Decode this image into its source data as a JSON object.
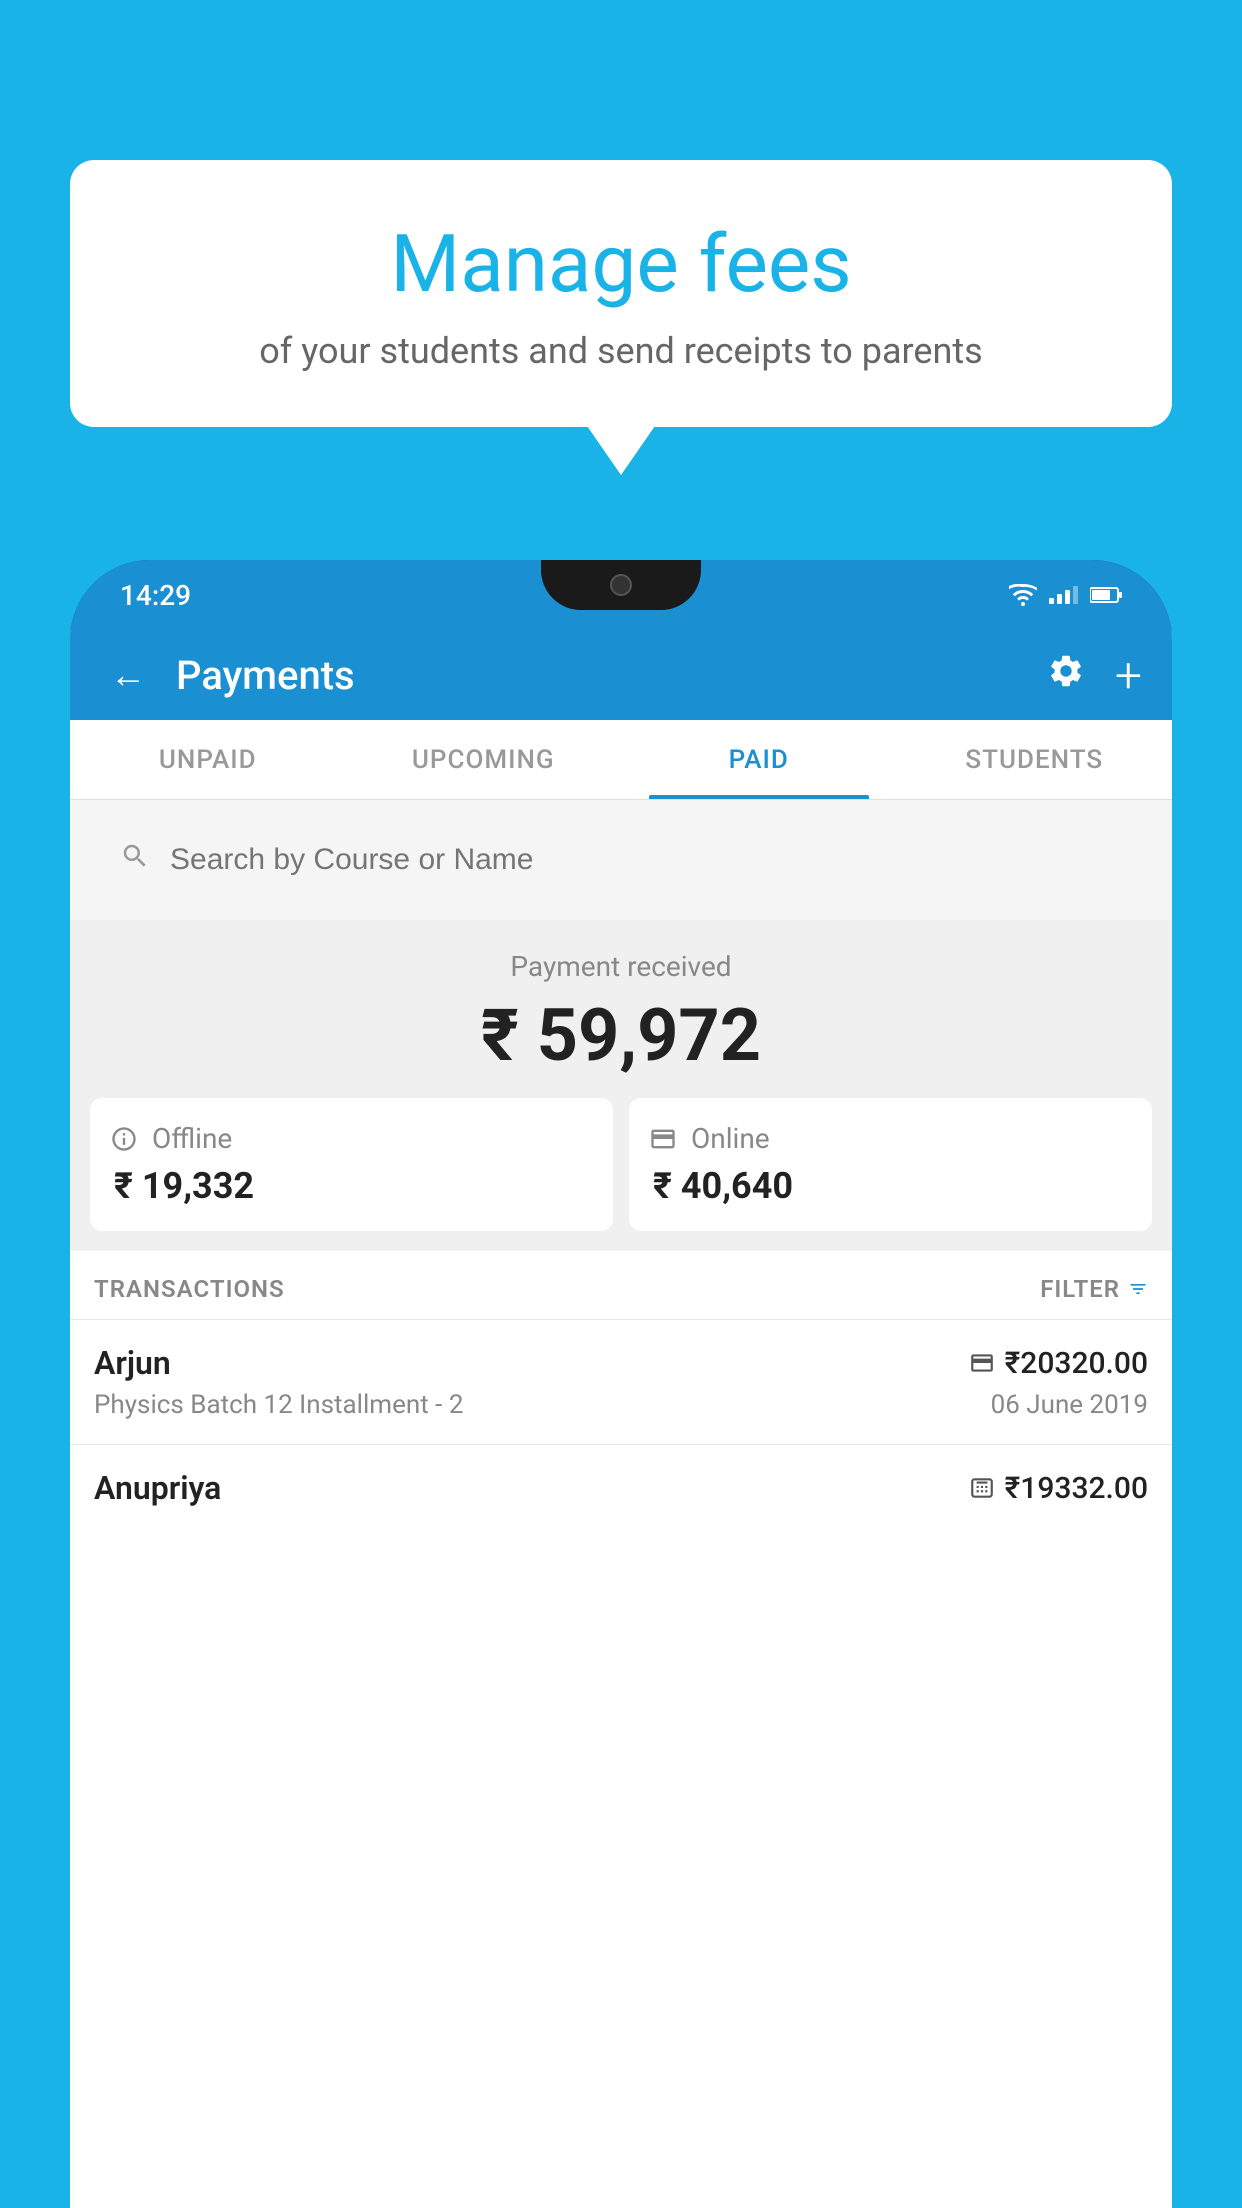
{
  "background_color": "#1ab3e8",
  "bubble": {
    "title": "Manage fees",
    "subtitle": "of your students and send receipts to parents"
  },
  "status_bar": {
    "time": "14:29"
  },
  "top_bar": {
    "title": "Payments",
    "back_label": "←",
    "gear_label": "⚙",
    "plus_label": "+"
  },
  "tabs": [
    {
      "label": "UNPAID",
      "active": false
    },
    {
      "label": "UPCOMING",
      "active": false
    },
    {
      "label": "PAID",
      "active": true
    },
    {
      "label": "STUDENTS",
      "active": false
    }
  ],
  "search": {
    "placeholder": "Search by Course or Name"
  },
  "payment_summary": {
    "label": "Payment received",
    "total": "₹ 59,972",
    "offline": {
      "label": "Offline",
      "amount": "₹ 19,332"
    },
    "online": {
      "label": "Online",
      "amount": "₹ 40,640"
    }
  },
  "transactions_section": {
    "label": "TRANSACTIONS",
    "filter_label": "FILTER"
  },
  "transactions": [
    {
      "name": "Arjun",
      "amount": "₹20320.00",
      "course": "Physics Batch 12 Installment - 2",
      "date": "06 June 2019",
      "payment_type": "card"
    },
    {
      "name": "Anupriya",
      "amount": "₹19332.00",
      "course": "",
      "date": "",
      "payment_type": "offline"
    }
  ]
}
